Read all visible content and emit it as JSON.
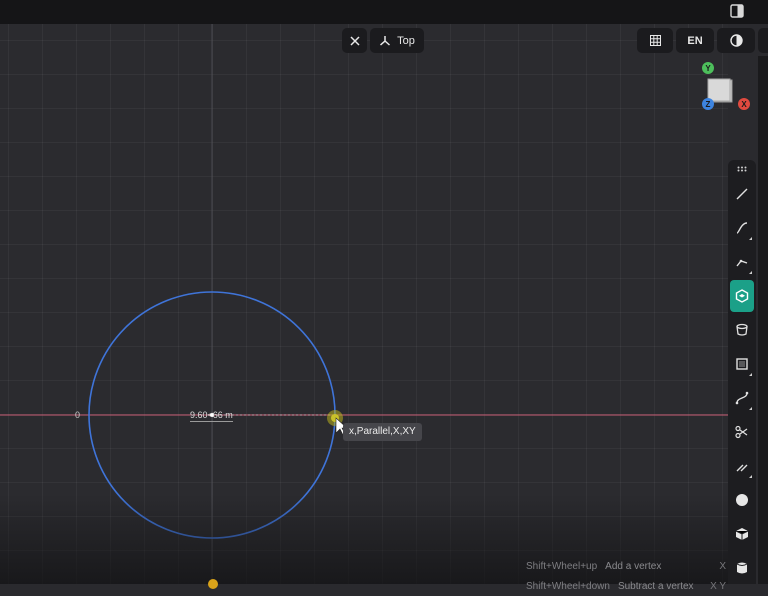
{
  "view": {
    "label": "Top"
  },
  "header": {
    "language": "EN"
  },
  "gizmo": {
    "x": "X",
    "y": "Y",
    "z": "Z"
  },
  "canvas": {
    "origin_label": "0",
    "radius_label": "9.60<66 m",
    "snap_tooltip": "x,Parallel,X,XY"
  },
  "hints": [
    {
      "keys": "Shift+Wheel+up",
      "action": "Add a vertex",
      "kbd": "X"
    },
    {
      "keys": "Shift+Wheel+down",
      "action": "Subtract a vertex",
      "kbd": "X Y"
    }
  ],
  "toolbar": {
    "tools": [
      "grip-icon",
      "line-icon",
      "curve-icon",
      "polyline-icon",
      "polygon-icon",
      "extrude-icon",
      "rectangle-icon",
      "bezier-icon",
      "trim-icon",
      "offset-icon",
      "sphere-icon",
      "cube-icon",
      "cylinder-icon"
    ],
    "active_tool": "polygon-icon"
  },
  "colors": {
    "accent": "#1ba088",
    "circle": "#3f74d9",
    "x_axis": "#c75d74",
    "gizmo_x": "#e04a3f",
    "gizmo_y": "#4dbf5c",
    "gizmo_z": "#3d84e0",
    "snap_point": "#b9b01e"
  }
}
